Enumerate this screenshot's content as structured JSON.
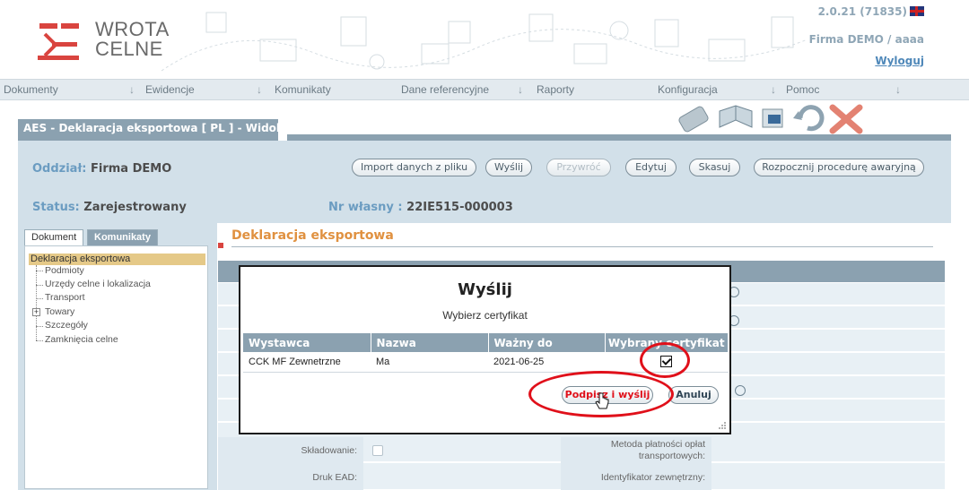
{
  "header": {
    "logo_line1": "WROTA",
    "logo_line2": "CELNE",
    "version": "2.0.21 (71835)",
    "company": "Firma DEMO / aaaa",
    "logout": "Wyloguj"
  },
  "menu": [
    {
      "label": "Dokumenty"
    },
    {
      "label": "Ewidencje"
    },
    {
      "label": "Komunikaty"
    },
    {
      "label": "Dane referencyjne"
    },
    {
      "label": "Raporty"
    },
    {
      "label": "Konfiguracja"
    },
    {
      "label": "Pomoc"
    }
  ],
  "title": "AES - Deklaracja eksportowa [ PL ]  - Widok",
  "info": {
    "branch_label": "Oddział:",
    "branch_value": "Firma DEMO",
    "status_label": "Status:",
    "status_value": "Zarejestrowany",
    "own_no_label": "Nr własny :",
    "own_no_value": "22IE515-000003"
  },
  "actions": {
    "import": "Import danych z pliku",
    "send": "Wyślij",
    "restore": "Przywróć",
    "edit": "Edytuj",
    "cancel": "Skasuj",
    "emergency": "Rozpocznij procedurę awaryjną"
  },
  "tabs": {
    "document": "Dokument",
    "messages": "Komunikaty"
  },
  "tree": {
    "root": "Deklaracja eksportowa",
    "items": [
      "Podmioty",
      "Urzędy celne i lokalizacja",
      "Transport",
      "Towary",
      "Szczegóły",
      "Zamknięcia celne"
    ]
  },
  "main": {
    "heading": "Deklaracja eksportowa",
    "storage_label": "Składowanie:",
    "ead_label": "Druk EAD:",
    "payment_label_1": "Metoda płatności opłat",
    "payment_label_2": "transportowych:",
    "ext_id_label": "Identyfikator zewnętrzny:"
  },
  "modal": {
    "title": "Wyślij",
    "subtitle": "Wybierz certyfikat",
    "columns": [
      "Wystawca",
      "Nazwa",
      "Ważny do",
      "Wybrany certyfikat"
    ],
    "rows": [
      {
        "issuer": "CCK MF Zewnetrzne",
        "name": "Ma",
        "valid_to": "2021-06-25",
        "selected": true
      }
    ],
    "sign_send": "Podpisz i wyślij",
    "cancel": "Anuluj"
  },
  "colors": {
    "accent_blue": "#8ba1b0",
    "panel_bg": "#d2e0e9",
    "annotation_red": "#e0101a",
    "heading_orange": "#e09140"
  }
}
